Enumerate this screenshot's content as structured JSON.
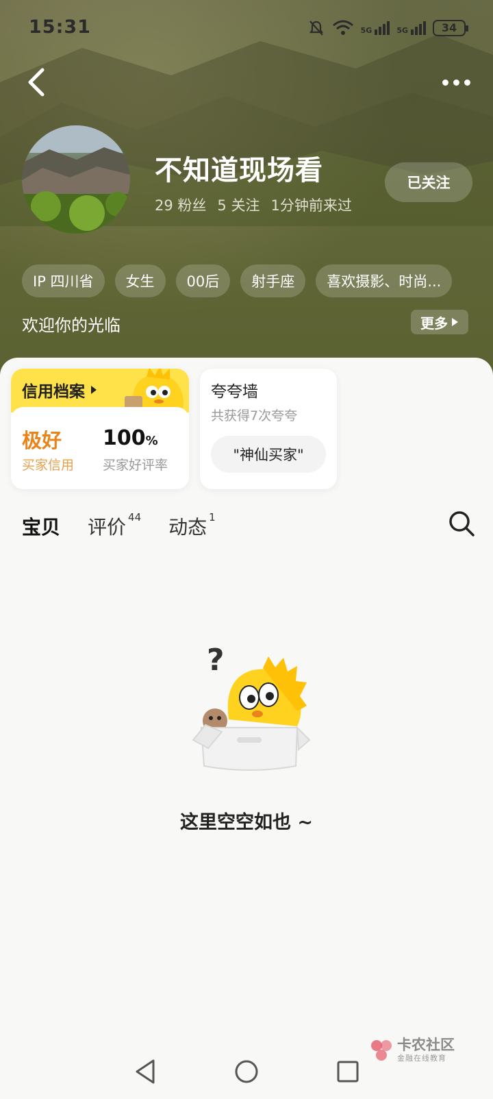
{
  "status_bar": {
    "time": "15:31",
    "battery": "34",
    "network_1": "5G",
    "network_2": "5G"
  },
  "header": {
    "nickname": "不知道现场看",
    "fans": "29 粉丝",
    "following": "5 关注",
    "last_seen": "1分钟前来过",
    "follow_label": "已关注",
    "tags": [
      "IP 四川省",
      "女生",
      "00后",
      "射手座",
      "喜欢摄影、时尚..."
    ],
    "welcome": "欢迎你的光临",
    "more_label": "更多"
  },
  "credit": {
    "title": "信用档案",
    "grade": "极好",
    "grade_label": "买家信用",
    "rate": "100",
    "rate_unit": "%",
    "rate_label": "买家好评率"
  },
  "praise": {
    "title": "夸夸墙",
    "subtitle": "共获得7次夸夸",
    "chip": "\"神仙买家\""
  },
  "tabs": [
    {
      "label": "宝贝",
      "count": ""
    },
    {
      "label": "评价",
      "count": "44"
    },
    {
      "label": "动态",
      "count": "1"
    }
  ],
  "empty_state": {
    "text": "这里空空如也 ~"
  },
  "watermark": {
    "name": "卡农社区",
    "sub": "金融在线教育"
  },
  "icons": {
    "back": "chevron-left-icon",
    "more": "more-dots-icon",
    "search": "search-icon",
    "nav_back": "nav-back-icon",
    "nav_home": "nav-home-icon",
    "nav_recent": "nav-recent-icon"
  },
  "colors": {
    "accent_yellow": "#ffe14a",
    "grade_orange": "#e8841a",
    "header_olive": "#6a6b3f"
  }
}
